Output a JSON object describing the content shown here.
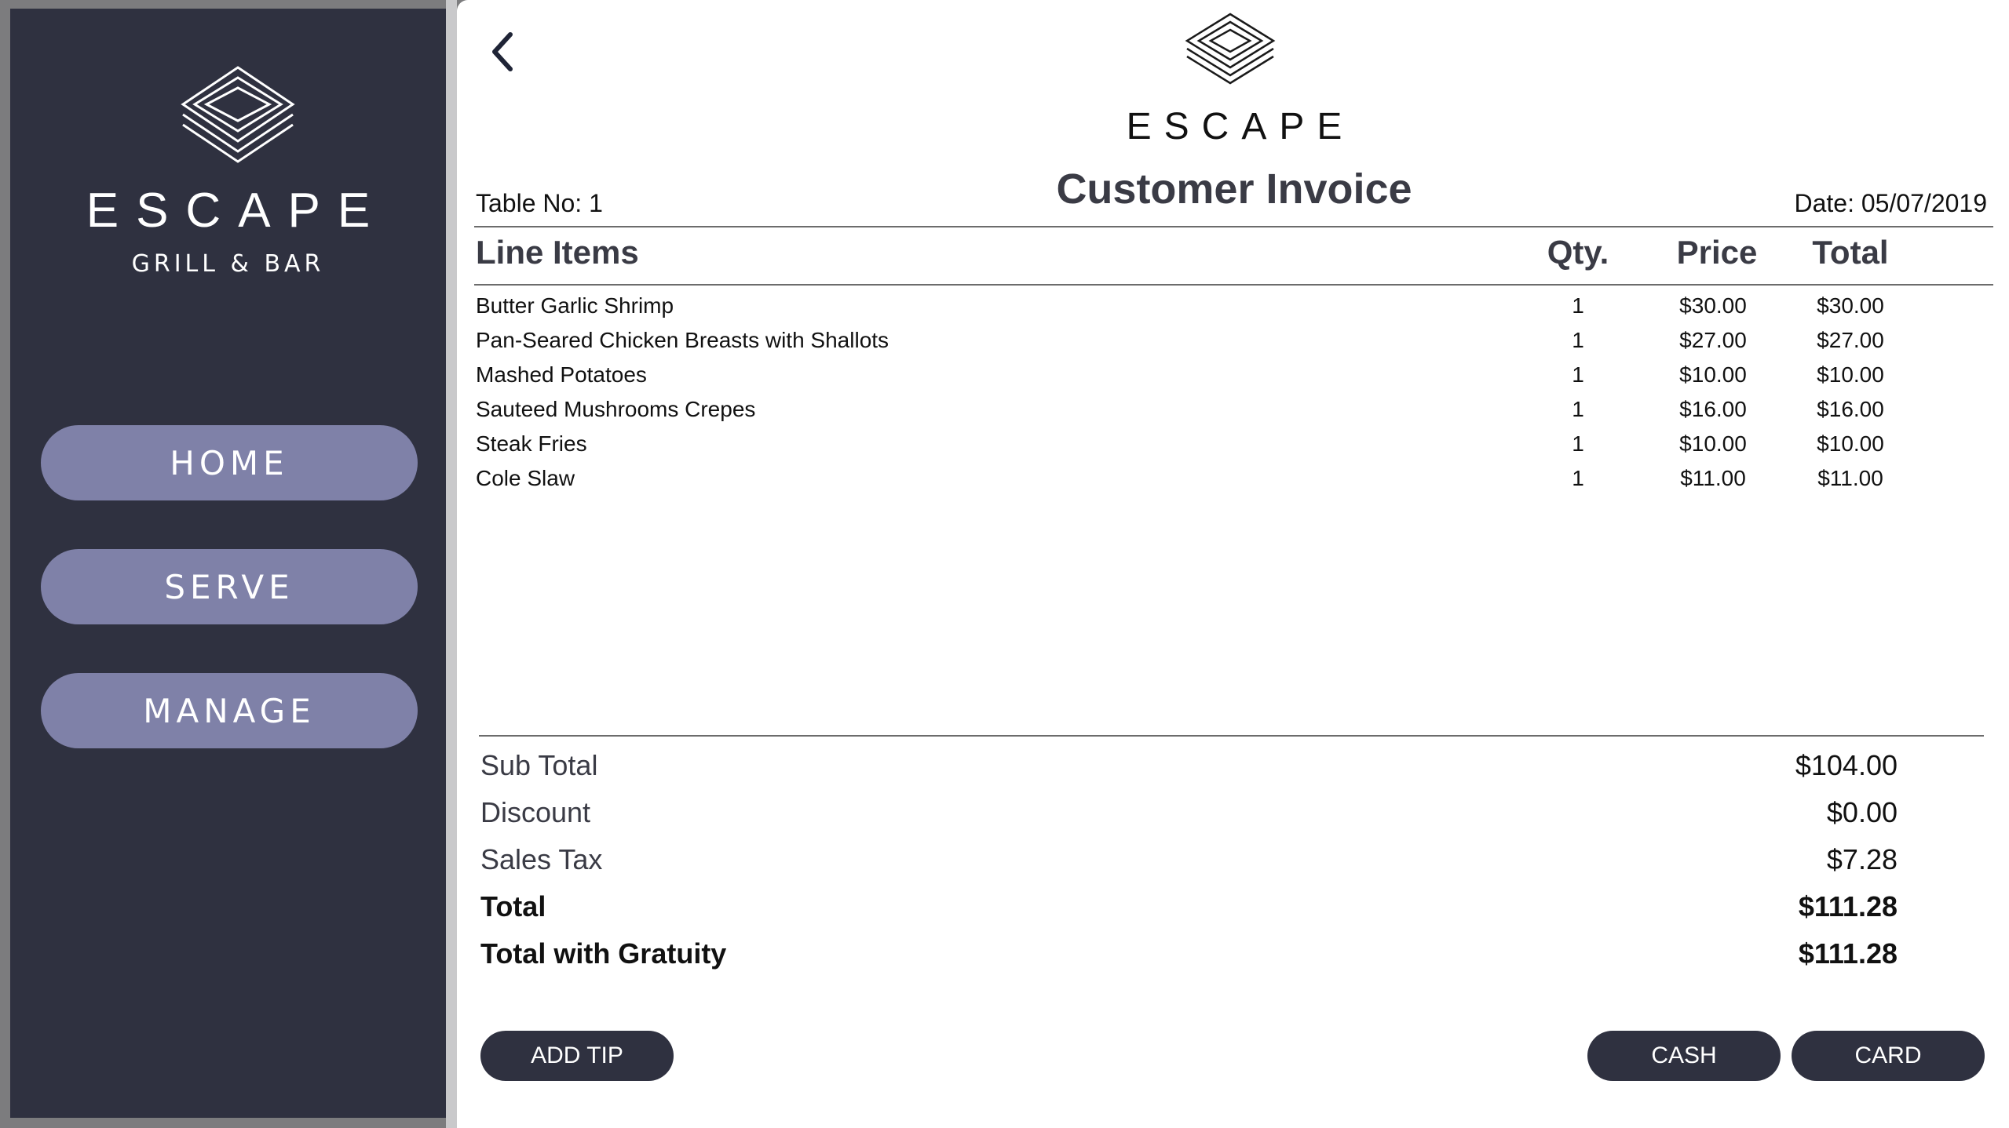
{
  "sidebar": {
    "brand": "ESCAPE",
    "subtitle": "GRILL & BAR",
    "nav": [
      {
        "label": "HOME"
      },
      {
        "label": "SERVE"
      },
      {
        "label": "MANAGE"
      }
    ]
  },
  "header": {
    "brand": "ESCAPE",
    "title": "Customer Invoice",
    "table_no": "Table No: 1",
    "date": "Date: 05/07/2019",
    "back_icon": "chevron-left-icon",
    "logo_icon": "layered-diamond-logo"
  },
  "columns": {
    "items": "Line Items",
    "qty": "Qty.",
    "price": "Price",
    "total": "Total"
  },
  "line_items": [
    {
      "name": "Butter Garlic Shrimp",
      "qty": "1",
      "price": "$30.00",
      "total": "$30.00"
    },
    {
      "name": "Pan-Seared Chicken Breasts with Shallots",
      "qty": "1",
      "price": "$27.00",
      "total": "$27.00"
    },
    {
      "name": "Mashed Potatoes",
      "qty": "1",
      "price": "$10.00",
      "total": "$10.00"
    },
    {
      "name": "Sauteed Mushrooms Crepes",
      "qty": "1",
      "price": "$16.00",
      "total": "$16.00"
    },
    {
      "name": "Steak Fries",
      "qty": "1",
      "price": "$10.00",
      "total": "$10.00"
    },
    {
      "name": "Cole Slaw",
      "qty": "1",
      "price": "$11.00",
      "total": "$11.00"
    }
  ],
  "summary": {
    "subtotal_label": "Sub Total",
    "subtotal": "$104.00",
    "discount_label": "Discount",
    "discount": "$0.00",
    "tax_label": "Sales Tax",
    "tax": "$7.28",
    "total_label": "Total",
    "total": "$111.28",
    "gratuity_label": "Total with Gratuity",
    "gratuity_total": "$111.28"
  },
  "actions": {
    "add_tip": "ADD TIP",
    "cash": "CASH",
    "card": "CARD"
  },
  "colors": {
    "sidebar_bg": "#2f3140",
    "nav_button": "#7f81a8",
    "action_button": "#2f3140"
  }
}
